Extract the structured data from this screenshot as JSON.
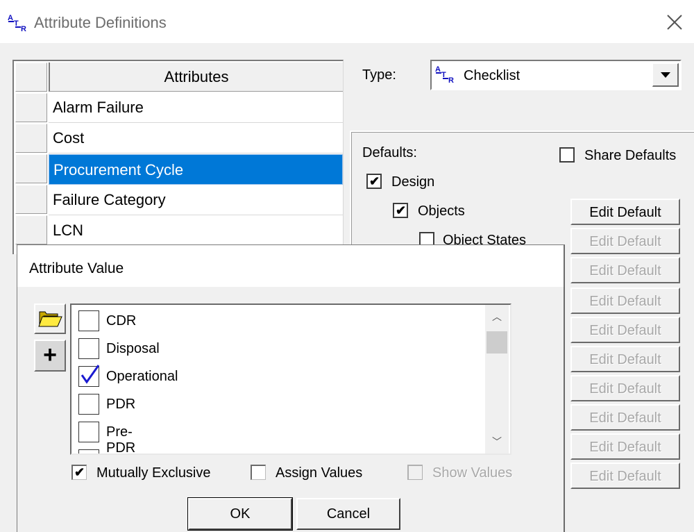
{
  "window": {
    "title": "Attribute Definitions",
    "close_icon": "close-icon",
    "app_icon": "attr-icon"
  },
  "attributes": {
    "header": "Attributes",
    "rows": [
      "Alarm Failure",
      "Cost",
      "Procurement Cycle",
      "Failure Category",
      "LCN"
    ],
    "selected": "Procurement Cycle"
  },
  "type": {
    "label": "Type:",
    "value": "Checklist",
    "dropdown_icon": "triangle-down-icon"
  },
  "defaults": {
    "label": "Defaults:",
    "share_label": "Share Defaults",
    "share_checked": false,
    "design_label": "Design",
    "design_checked": true,
    "objects_label": "Objects",
    "objects_checked": true,
    "object_states_label": "Object States",
    "object_states_checked": false,
    "edit_buttons": [
      {
        "label": "Edit Default",
        "enabled": true
      },
      {
        "label": "Edit Default",
        "enabled": false
      },
      {
        "label": "Edit Default",
        "enabled": false
      },
      {
        "label": "Edit Default",
        "enabled": false
      },
      {
        "label": "Edit Default",
        "enabled": false
      },
      {
        "label": "Edit Default",
        "enabled": false
      },
      {
        "label": "Edit Default",
        "enabled": false
      },
      {
        "label": "Edit Default",
        "enabled": false
      },
      {
        "label": "Edit Default",
        "enabled": false
      },
      {
        "label": "Edit Default",
        "enabled": false
      }
    ]
  },
  "dialog": {
    "title": "Attribute Value",
    "folder_icon": "folder-open-icon",
    "plus_label": "+",
    "values": [
      {
        "label": "CDR",
        "checked": false
      },
      {
        "label": "Disposal",
        "checked": false
      },
      {
        "label": "Operational",
        "checked": true
      },
      {
        "label": "PDR",
        "checked": false
      },
      {
        "label": "Pre-PDR",
        "checked": false
      }
    ],
    "mutually_exclusive_label": "Mutually Exclusive",
    "mutually_exclusive_checked": true,
    "assign_values_label": "Assign Values",
    "assign_values_checked": false,
    "show_values_label": "Show Values",
    "show_values_enabled": false,
    "ok_label": "OK",
    "cancel_label": "Cancel",
    "check_glyph": "✔"
  },
  "colors": {
    "selection": "#0078d7",
    "check_blue": "#1a1ad0"
  }
}
